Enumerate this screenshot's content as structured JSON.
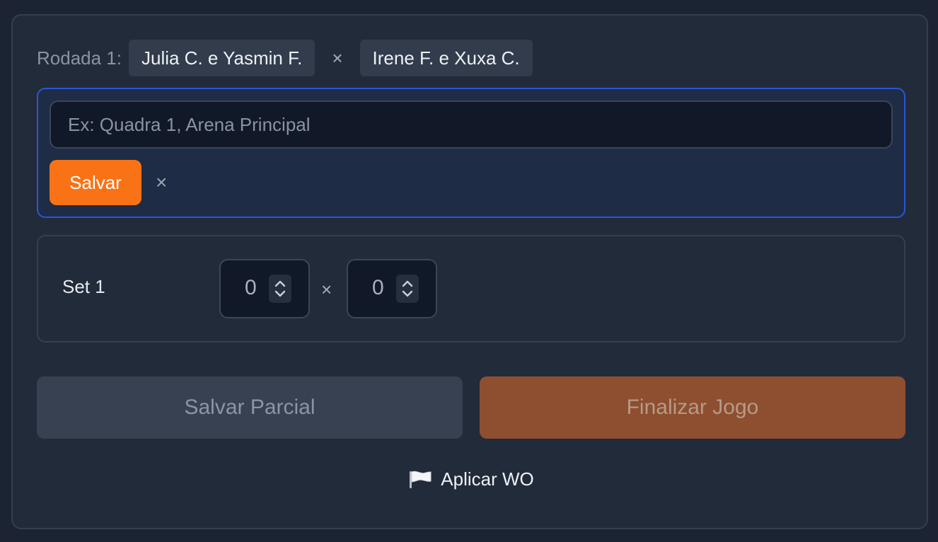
{
  "match": {
    "round_label": "Rodada 1:",
    "team_a": "Julia C. e Yasmin F.",
    "vs_symbol": "×",
    "team_b": "Irene F. e Xuxa C."
  },
  "court_editor": {
    "input_value": "",
    "placeholder": "Ex: Quadra 1, Arena Principal",
    "save_label": "Salvar",
    "cancel_symbol": "×"
  },
  "sets": [
    {
      "label": "Set 1",
      "score_a": "0",
      "score_b": "0",
      "separator": "×"
    }
  ],
  "actions": {
    "save_partial_label": "Salvar Parcial",
    "finish_label": "Finalizar Jogo",
    "wo_label": "Aplicar WO",
    "wo_icon": "white-flag-icon"
  },
  "colors": {
    "accent": "#f97316",
    "finish_disabled": "#8d4f30",
    "focus_border": "#2b55d6"
  }
}
